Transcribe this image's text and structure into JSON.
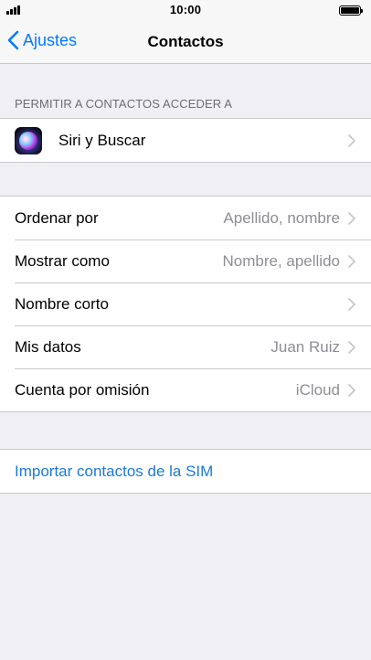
{
  "status_bar": {
    "time": "10:00"
  },
  "nav": {
    "back_label": "Ajustes",
    "title": "Contactos"
  },
  "access_section": {
    "header": "PERMITIR A CONTACTOS ACCEDER A",
    "items": [
      {
        "label": "Siri y Buscar",
        "icon": "siri-icon"
      }
    ]
  },
  "settings": {
    "items": [
      {
        "label": "Ordenar por",
        "value": "Apellido, nombre"
      },
      {
        "label": "Mostrar como",
        "value": "Nombre, apellido"
      },
      {
        "label": "Nombre corto",
        "value": ""
      },
      {
        "label": "Mis datos",
        "value": "Juan Ruiz"
      },
      {
        "label": "Cuenta por omisión",
        "value": "iCloud"
      }
    ]
  },
  "import": {
    "label": "Importar contactos de la SIM"
  },
  "colors": {
    "accent": "#007aff",
    "link": "#1b7ad6",
    "background": "#efeff4",
    "secondary_text": "#8e8e93"
  }
}
